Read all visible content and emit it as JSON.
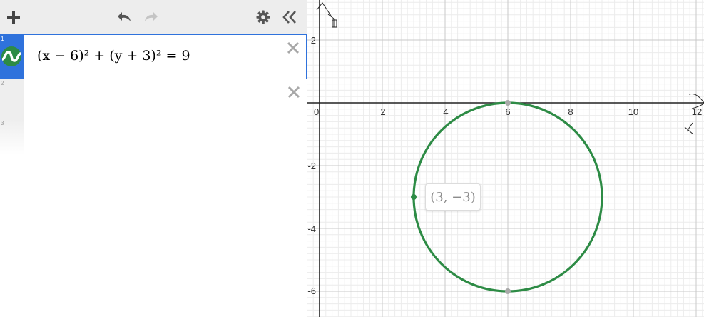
{
  "toolbar": {
    "add_icon": "plus-icon",
    "undo_icon": "undo-icon",
    "redo_icon": "redo-icon",
    "settings_icon": "gear-icon",
    "collapse_icon": "double-chevron-left-icon"
  },
  "expressions": [
    {
      "index": "1",
      "latex": "(x − 6)² + (y + 3)² = 9",
      "color": "#2d8b45"
    },
    {
      "index": "2",
      "latex": ""
    },
    {
      "index": "3",
      "latex": ""
    }
  ],
  "graph": {
    "x_ticks": [
      "0",
      "2",
      "4",
      "6",
      "8",
      "10",
      "12"
    ],
    "y_ticks": [
      "2",
      "-2",
      "-4",
      "-6"
    ],
    "point_label": "(3, −3)",
    "curve_color": "#2d8b45",
    "axis_color": "#222222"
  },
  "chart_data": {
    "type": "scatter",
    "xlim": [
      -0.3,
      12.3
    ],
    "ylim": [
      -6.7,
      3.3
    ],
    "grid": true,
    "series": [
      {
        "name": "",
        "curve": "circle",
        "center": [
          6,
          -3
        ],
        "radius": 3
      }
    ],
    "points": [
      {
        "x": 6,
        "y": 0
      },
      {
        "x": 6,
        "y": -6
      },
      {
        "x": 3,
        "y": -3
      }
    ]
  }
}
